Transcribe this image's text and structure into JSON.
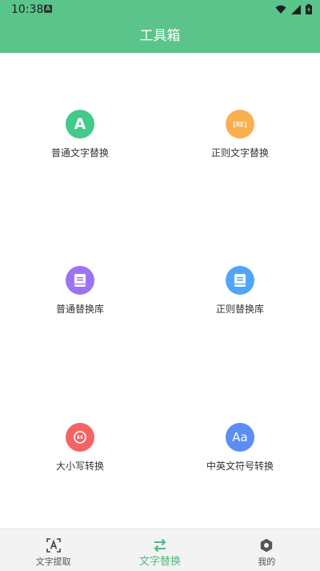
{
  "status_bar": {
    "time": "10:38",
    "notification_icon": "a-icon",
    "icons": [
      "wifi-icon",
      "signal-icon",
      "battery-icon"
    ]
  },
  "app_bar": {
    "title": "工具箱"
  },
  "tools": [
    {
      "label": "普通文字替换",
      "icon": "letter-a-icon",
      "color": "#43c98b",
      "glyph": "A"
    },
    {
      "label": "正则文字替换",
      "icon": "regex-icon",
      "color": "#fbb04f",
      "glyph": "[RE]"
    },
    {
      "label": "普通替换库",
      "icon": "book-icon",
      "color": "#9c74f2",
      "glyph": ""
    },
    {
      "label": "正则替换库",
      "icon": "book-icon",
      "color": "#4fa6f8",
      "glyph": ""
    },
    {
      "label": "大小写转换",
      "icon": "quote-icon",
      "color": "#f26565",
      "glyph": "“"
    },
    {
      "label": "中英文符号转换",
      "icon": "aa-icon",
      "color": "#5b8df4",
      "glyph": "Aa"
    }
  ],
  "bottom_nav": {
    "items": [
      {
        "label": "文字提取",
        "icon": "text-scan-icon",
        "active": false
      },
      {
        "label": "文字替换",
        "icon": "swap-icon",
        "active": true
      },
      {
        "label": "我的",
        "icon": "hexagon-icon",
        "active": false
      }
    ]
  },
  "colors": {
    "primary": "#5bc48a",
    "active_tab": "#52b97d",
    "nav_background": "#f3f3f3"
  }
}
